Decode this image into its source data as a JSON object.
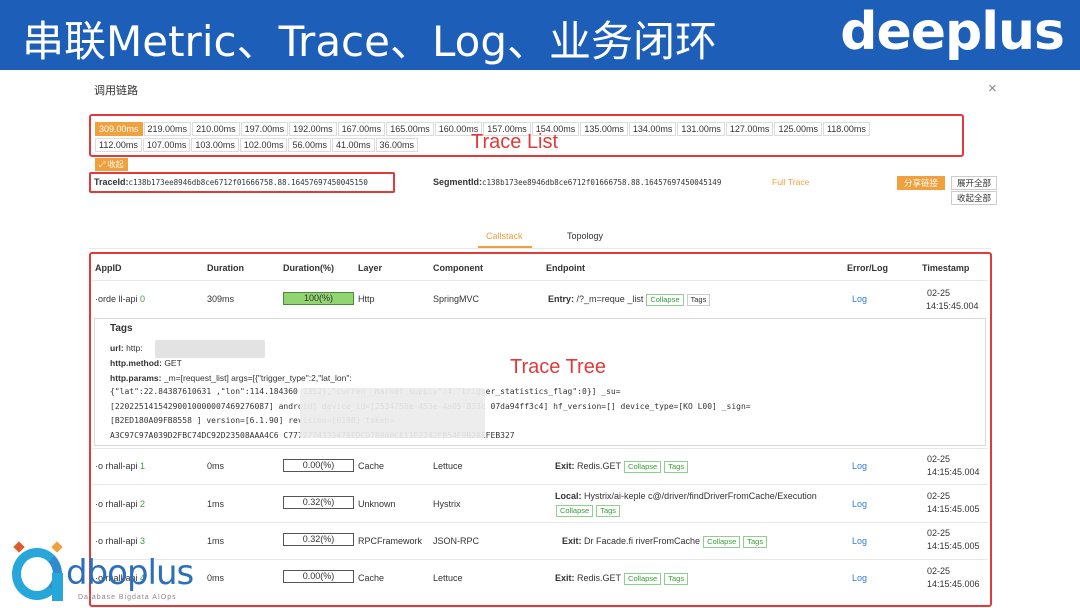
{
  "banner": {
    "title": "串联Metric、Trace、Log、业务闭环",
    "logo": "deeplus"
  },
  "dialog": {
    "title": "调用链路",
    "close": "×"
  },
  "trace_list": {
    "row1": [
      "309.00ms",
      "219.00ms",
      "210.00ms",
      "197.00ms",
      "192.00ms",
      "167.00ms",
      "165.00ms",
      "160.00ms",
      "157.00ms",
      "154.00ms",
      "135.00ms",
      "134.00ms",
      "131.00ms",
      "127.00ms",
      "125.00ms",
      "118.00ms"
    ],
    "row2": [
      "112.00ms",
      "107.00ms",
      "103.00ms",
      "102.00ms",
      "56.00ms",
      "41.00ms",
      "36.00ms"
    ],
    "collapse_label": "⤢ 收起"
  },
  "annotations": {
    "trace_list": "Trace List",
    "trace_tree": "Trace Tree"
  },
  "ids": {
    "trace_label": "TraceId:",
    "trace_value": "c138b173ee8946db8ce6712f01666758.88.16457697450045150",
    "segment_label": "SegmentId:",
    "segment_value": "c138b173ee8946db8ce6712f01666758.88.16457697450045149",
    "full_trace": "Full Trace",
    "share": "分享链接",
    "expand_all": "展开全部",
    "collapse_all": "收起全部"
  },
  "tabs": {
    "callstack": "Callstack",
    "topology": "Topology"
  },
  "table": {
    "headers": {
      "appid": "AppID",
      "duration": "Duration",
      "duration_pct": "Duration(%)",
      "layer": "Layer",
      "component": "Component",
      "endpoint": "Endpoint",
      "errorlog": "Error/Log",
      "timestamp": "Timestamp"
    },
    "rows": [
      {
        "app": "·orde    ll-api",
        "level": "0",
        "duration": "309ms",
        "pct": "100(%)",
        "layer": "Http",
        "component": "SpringMVC",
        "ep_kind": "Entry:",
        "ep_text": "/?_m=reque    _list",
        "log": "Log",
        "ts_date": "02-25",
        "ts_time": "14:15:45.004"
      },
      {
        "app": "·o    rhall-api",
        "level": "1",
        "duration": "0ms",
        "pct": "0.00(%)",
        "layer": "Cache",
        "component": "Lettuce",
        "ep_kind": "Exit:",
        "ep_text": "Redis.GET",
        "log": "Log",
        "ts_date": "02-25",
        "ts_time": "14:15:45.004"
      },
      {
        "app": "·o    rhall-api",
        "level": "2",
        "duration": "1ms",
        "pct": "0.32(%)",
        "layer": "Unknown",
        "component": "Hystrix",
        "ep_kind": "Local:",
        "ep_text": "Hystrix/ai-keple     c@/driver/findDriverFromCache/Execution",
        "log": "Log",
        "ts_date": "02-25",
        "ts_time": "14:15:45.005"
      },
      {
        "app": "·o    rhall-api",
        "level": "3",
        "duration": "1ms",
        "pct": "0.32(%)",
        "layer": "RPCFramework",
        "component": "JSON-RPC",
        "ep_kind": "Exit:",
        "ep_text": "Dr     Facade.fi     riverFromCache",
        "log": "Log",
        "ts_date": "02-25",
        "ts_time": "14:15:45.005"
      },
      {
        "app": "·o    rhall-api",
        "level": "4",
        "duration": "0ms",
        "pct": "0.00(%)",
        "layer": "Cache",
        "component": "Lettuce",
        "ep_kind": "Exit:",
        "ep_text": "Redis.GET",
        "log": "Log",
        "ts_date": "02-25",
        "ts_time": "14:15:45.006"
      }
    ],
    "btn_collapse": "Collapse",
    "btn_tags": "Tags"
  },
  "tags_panel": {
    "title": "Tags",
    "url_label": "url:",
    "url_value": "http:",
    "method_label": "http.method:",
    "method_value": "GET",
    "params_label": "http.params:",
    "params_line1": "_m=[request_list] args=[{\"trigger_type\":2,\"lat_lon\":",
    "params_line2": "{\"lat\":22.84387610631      ,\"lon\":114.184360      1352},\"curren       _market_supply\":4,\"trigger_statistics_flag\":0}] _su=",
    "params_line3": "[22022514154290010000007469276087]            android] device_id=[2534758a-453e-4a05-833c     07da94ff3c4] hf_version=[] device_type=[KO     L00] _sign=",
    "params_line4": "[B2ED180A09FB8558             ] version=[6.1.90] revision=[6198] token=",
    "params_line5": "          A3C97C97A039D2FBC74DC92D23508AAA4C6      C777277433347BEDCD788A0CE11E2242EB54E9B28EFEB327"
  },
  "corner_logo": {
    "text": "dboplus",
    "sub": "Database  Bigdata  AIOps"
  }
}
